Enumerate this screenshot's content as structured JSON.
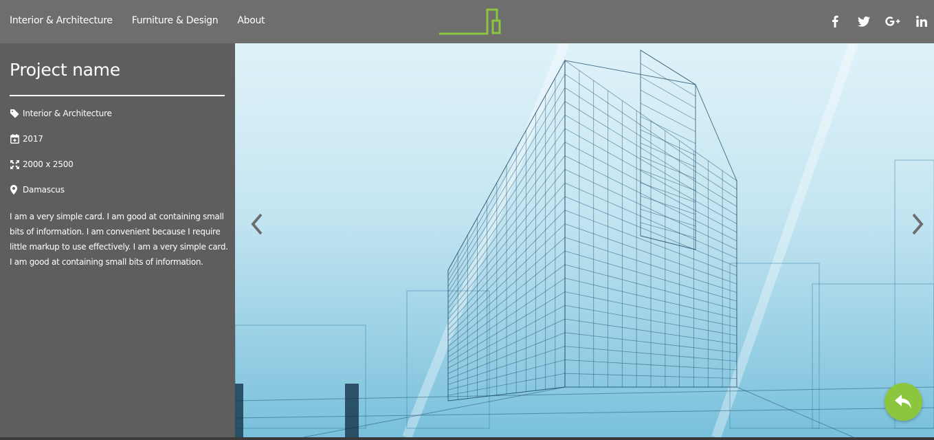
{
  "nav": {
    "links": [
      {
        "label": "Interior & Architecture"
      },
      {
        "label": "Furniture & Design"
      },
      {
        "label": "About"
      }
    ],
    "logo_color": "#8cc63f",
    "social": [
      "facebook-icon",
      "twitter-icon",
      "google-plus-icon",
      "linkedin-icon"
    ]
  },
  "project": {
    "title": "Project name",
    "category": "Interior & Architecture",
    "year": "2017",
    "dimensions": "2000 x 2500",
    "location": "Damascus",
    "description": "I am a very simple card. I am good at containing small bits of information. I am convenient because I require little markup to use effectively. I am a very simple card. I am good at containing small bits of information."
  },
  "carousel": {
    "image": "architecture-wireframe-building",
    "prev_icon": "chevron-left-icon",
    "next_icon": "chevron-right-icon"
  },
  "fab": {
    "icon": "reply-icon",
    "color": "#8cc63f"
  },
  "colors": {
    "navbar": "#6e6e6e",
    "sidebar": "#5e5e5e",
    "accent": "#8cc63f"
  }
}
